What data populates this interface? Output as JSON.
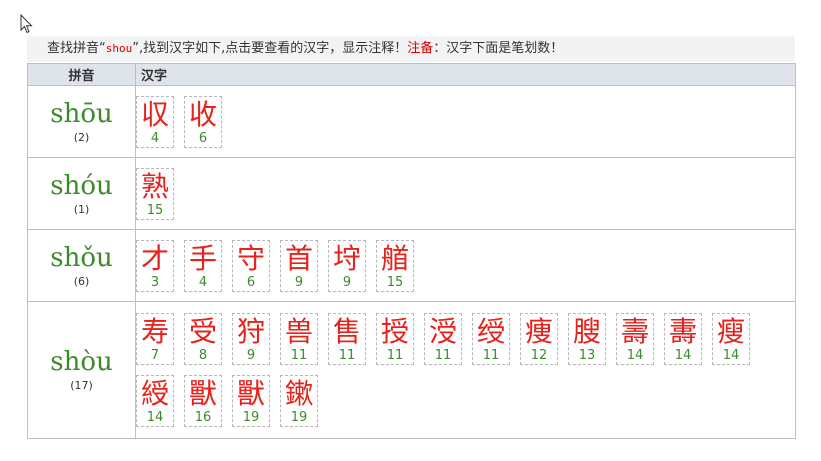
{
  "info": {
    "prefix": "查找拼音“",
    "query": "shou",
    "suffix": "”,找到汉字如下,点击要查看的汉字，显示注释！",
    "note_label": "注备",
    "note_text": "：汉字下面是笔划数！"
  },
  "table": {
    "header_pinyin": "拼音",
    "header_hanzi": "汉字"
  },
  "rows": [
    {
      "pinyin": "shōu",
      "count": "(2)",
      "chars": [
        {
          "char": "収",
          "strokes": "4"
        },
        {
          "char": "收",
          "strokes": "6"
        }
      ]
    },
    {
      "pinyin": "shóu",
      "count": "(1)",
      "chars": [
        {
          "char": "熟",
          "strokes": "15"
        }
      ]
    },
    {
      "pinyin": "shǒu",
      "count": "(6)",
      "chars": [
        {
          "char": "才",
          "strokes": "3"
        },
        {
          "char": "手",
          "strokes": "4"
        },
        {
          "char": "守",
          "strokes": "6"
        },
        {
          "char": "首",
          "strokes": "9"
        },
        {
          "char": "垨",
          "strokes": "9"
        },
        {
          "char": "艏",
          "strokes": "15"
        }
      ]
    },
    {
      "pinyin": "shòu",
      "count": "(17)",
      "chars": [
        {
          "char": "寿",
          "strokes": "7"
        },
        {
          "char": "受",
          "strokes": "8"
        },
        {
          "char": "狩",
          "strokes": "9"
        },
        {
          "char": "兽",
          "strokes": "11"
        },
        {
          "char": "售",
          "strokes": "11"
        },
        {
          "char": "授",
          "strokes": "11"
        },
        {
          "char": "涭",
          "strokes": "11"
        },
        {
          "char": "绶",
          "strokes": "11"
        },
        {
          "char": "痩",
          "strokes": "12"
        },
        {
          "char": "膄",
          "strokes": "13"
        },
        {
          "char": "壽",
          "strokes": "14"
        },
        {
          "char": "夀",
          "strokes": "14"
        },
        {
          "char": "瘦",
          "strokes": "14"
        },
        {
          "char": "綬",
          "strokes": "14"
        },
        {
          "char": "獸",
          "strokes": "16"
        },
        {
          "char": "獸",
          "strokes": "19"
        },
        {
          "char": "鏉",
          "strokes": "19"
        }
      ]
    }
  ]
}
